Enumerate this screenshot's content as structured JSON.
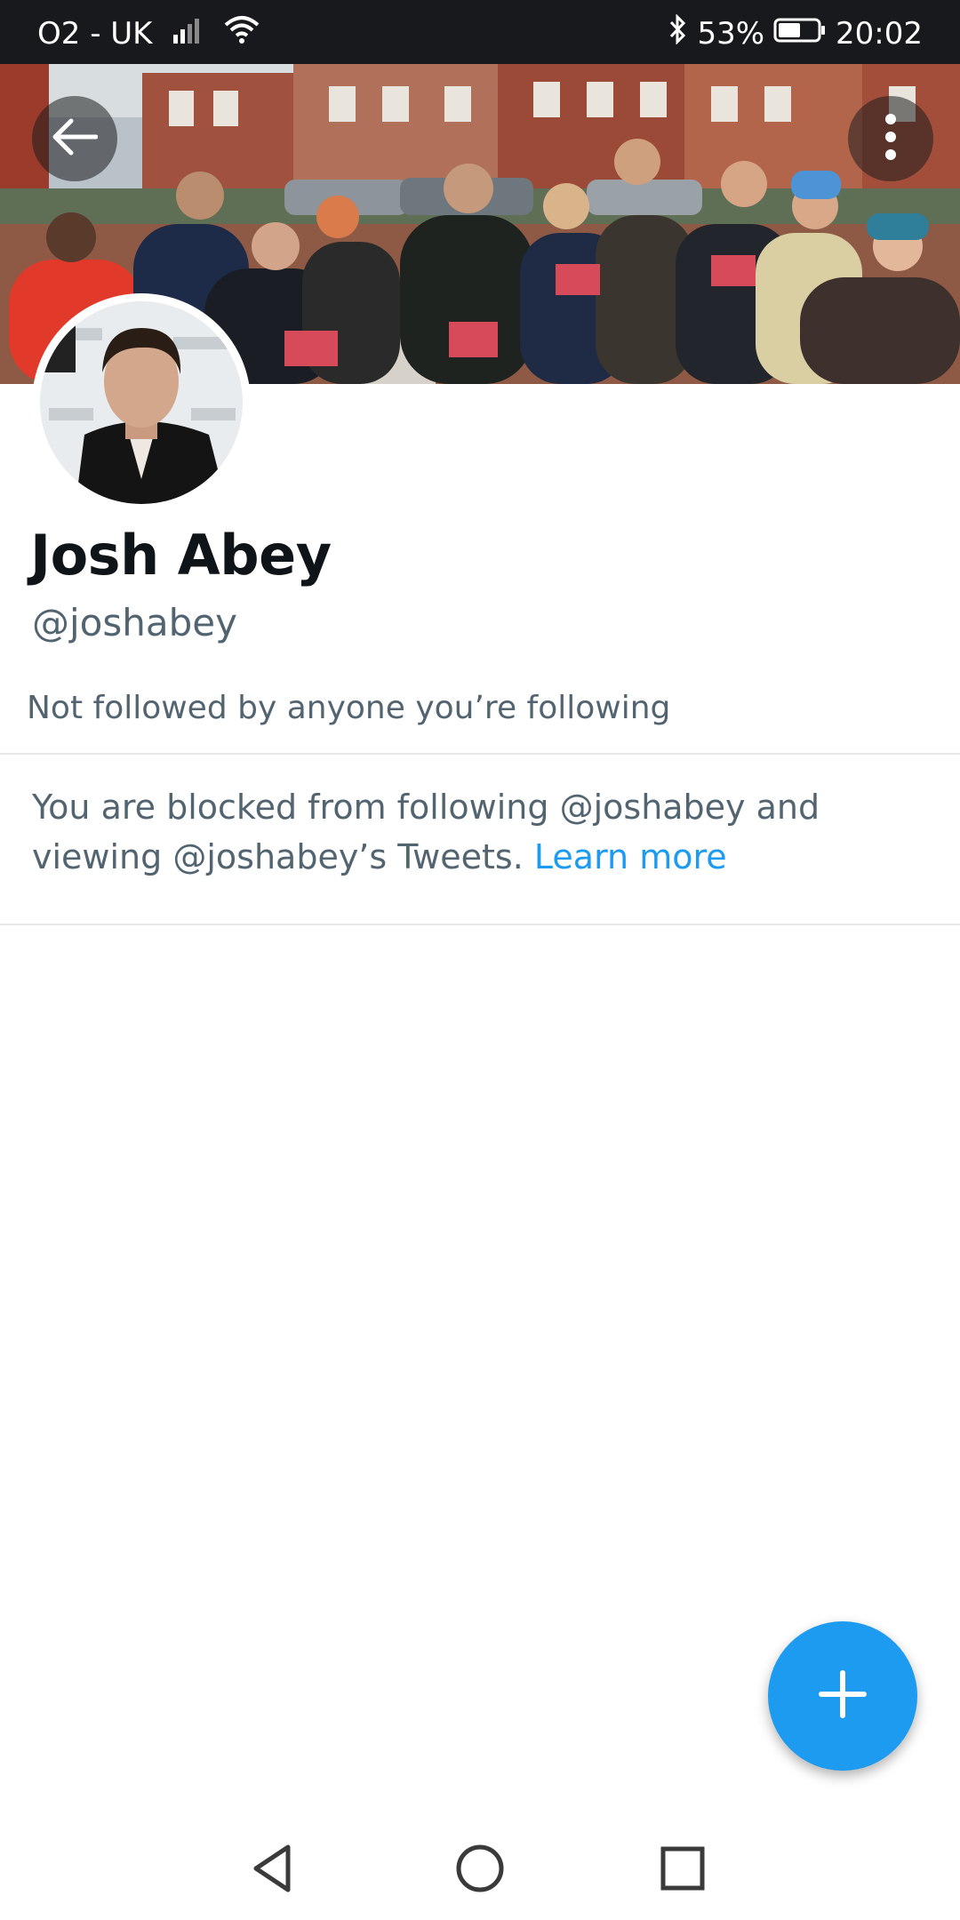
{
  "status_bar": {
    "carrier": "O2 - UK",
    "battery_percent": "53%",
    "time": "20:02",
    "icons": [
      "signal-icon",
      "wifi-icon",
      "bluetooth-icon",
      "battery-icon"
    ]
  },
  "header": {
    "back_icon": "back-arrow-icon",
    "more_icon": "more-vertical-icon"
  },
  "profile": {
    "display_name": "Josh Abey",
    "handle": "@joshabey",
    "followed_by": "Not followed by anyone you’re following",
    "blocked_message": "You are blocked from following @joshabey and viewing @joshabey’s Tweets.",
    "learn_more": "Learn more"
  },
  "fab": {
    "icon": "plus-icon"
  },
  "colors": {
    "accent": "#1d9bf0",
    "secondary_text": "#536471",
    "status_bar_bg": "#17191c"
  },
  "nav": {
    "icons": [
      "nav-back-icon",
      "nav-home-icon",
      "nav-recents-icon"
    ]
  }
}
